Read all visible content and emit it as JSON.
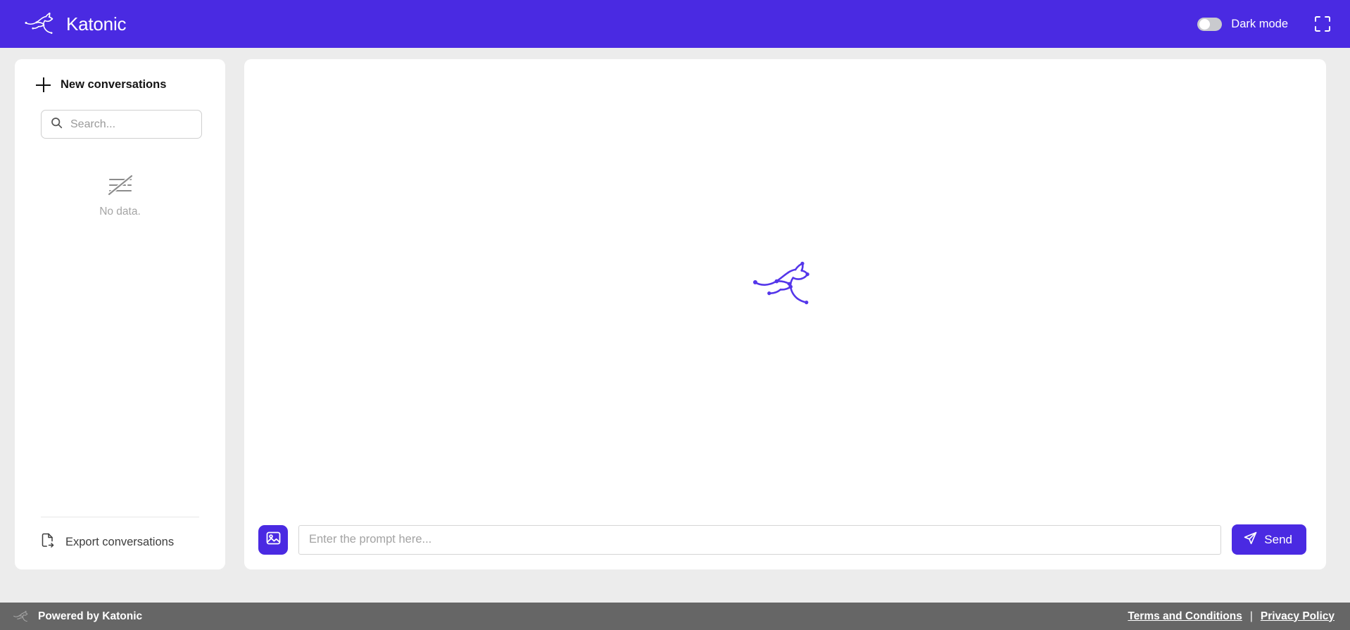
{
  "header": {
    "brand_name": "Katonic",
    "logo_icon": "kangaroo-logo",
    "dark_mode_label": "Dark mode",
    "dark_mode_enabled": false,
    "fullscreen_icon": "fullscreen-expand-icon"
  },
  "sidebar": {
    "new_conversation_label": "New conversations",
    "new_conversation_icon": "plus-icon",
    "search": {
      "icon": "search-icon",
      "value": "",
      "placeholder": "Search..."
    },
    "empty_state": {
      "icon": "no-data-crossed-list-icon",
      "text": "No data."
    },
    "export_label": "Export conversations",
    "export_icon": "file-export-icon"
  },
  "main": {
    "watermark_icon": "kangaroo-watermark",
    "composer": {
      "image_button_icon": "image-upload-icon",
      "prompt_value": "",
      "prompt_placeholder": "Enter the prompt here...",
      "send_label": "Send",
      "send_icon": "paper-plane-icon"
    }
  },
  "footer": {
    "logo_icon": "kangaroo-logo-small",
    "powered_by": "Powered by Katonic",
    "terms_link": "Terms and Conditions",
    "separator": "|",
    "privacy_link": "Privacy Policy"
  },
  "colors": {
    "brand_purple": "#4a2ae2",
    "page_background": "#ececec",
    "panel_background": "#ffffff",
    "footer_background": "#666666",
    "muted_text": "#a5a5a5"
  }
}
